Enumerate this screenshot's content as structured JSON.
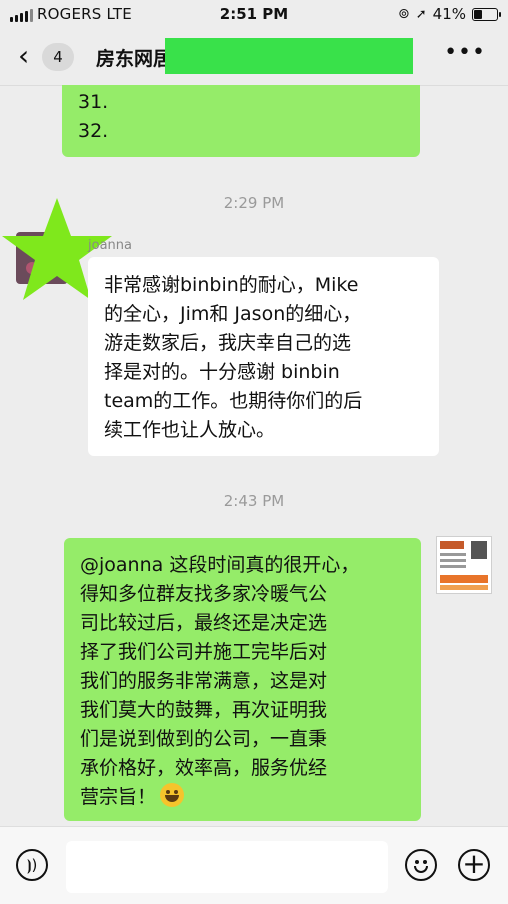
{
  "status_bar": {
    "carrier": "ROGERS  LTE",
    "time": "2:51 PM",
    "battery_text": "41%",
    "battery_level": 0.41
  },
  "nav": {
    "back_icon": "chevron-left-icon",
    "unread_badge": "4",
    "title": "房东网居",
    "more_icon": "ellipsis-icon",
    "redaction_color": "#39e14a"
  },
  "messages": [
    {
      "type": "outgoing",
      "lines": [
        "31.",
        "32."
      ]
    },
    {
      "type": "timestamp",
      "text": "2:29 PM"
    },
    {
      "type": "incoming",
      "sender": "joanna",
      "lines": [
        "非常感谢binbin的耐心，Mike",
        "的全心，Jim和 Jason的细心，",
        "游走数家后，我庆幸自己的选",
        "择是对的。十分感谢 binbin",
        "team的工作。也期待你们的后",
        "续工作也让人放心。"
      ]
    },
    {
      "type": "timestamp",
      "text": "2:43 PM"
    },
    {
      "type": "outgoing",
      "lines": [
        "@joanna 这段时间真的很开心，",
        "得知多位群友找多家冷暖气公",
        "司比较过后，最终还是决定选",
        "择了我们公司并施工完毕后对",
        "我们的服务非常满意，这是对",
        "我们莫大的鼓舞，再次证明我",
        "们是说到做到的公司，一直秉",
        "承价格好，效率高，服务优经",
        "营宗旨！"
      ],
      "emoji": "grinning-face-emoji"
    }
  ],
  "input_bar": {
    "voice_icon": "voice-icon",
    "emoji_icon": "smiley-icon",
    "plus_icon": "plus-icon"
  },
  "colors": {
    "outgoing_bubble": "#95EC69",
    "incoming_bubble": "#FFFFFF",
    "background": "#EDEDED",
    "star_overlay": "#7FE81C"
  }
}
